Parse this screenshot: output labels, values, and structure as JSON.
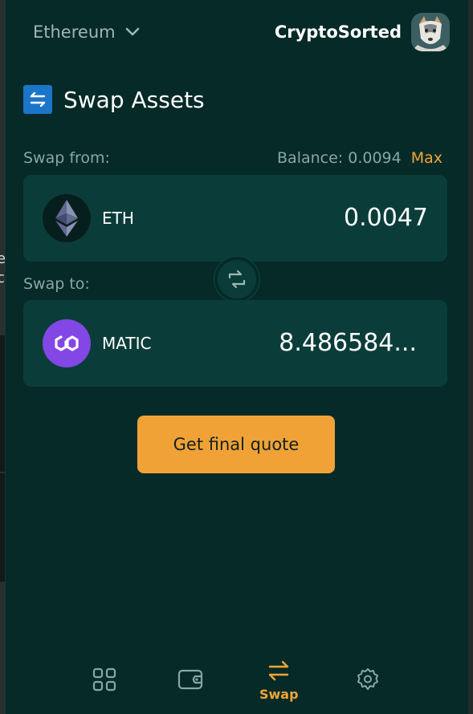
{
  "header": {
    "network": "Ethereum",
    "account_name": "CryptoSorted"
  },
  "page": {
    "title": "Swap Assets"
  },
  "swap_from": {
    "label": "Swap from:",
    "balance_label": "Balance: 0.0094",
    "max_label": "Max",
    "token_symbol": "ETH",
    "amount": "0.0047"
  },
  "swap_to": {
    "label": "Swap to:",
    "token_symbol": "MATIC",
    "amount": "8.486584..."
  },
  "actions": {
    "quote_button": "Get final quote"
  },
  "nav": {
    "items": [
      {
        "icon": "grid-icon",
        "label": ""
      },
      {
        "icon": "wallet-icon",
        "label": ""
      },
      {
        "icon": "swap-icon",
        "label": "Swap"
      },
      {
        "icon": "gear-icon",
        "label": ""
      }
    ],
    "active": "Swap"
  },
  "colors": {
    "panel_bg": "#052a27",
    "card_bg": "#0a3d39",
    "accent": "#f0a536",
    "title_icon_bg": "#1b75c8",
    "matic_purple": "#8247e5"
  }
}
